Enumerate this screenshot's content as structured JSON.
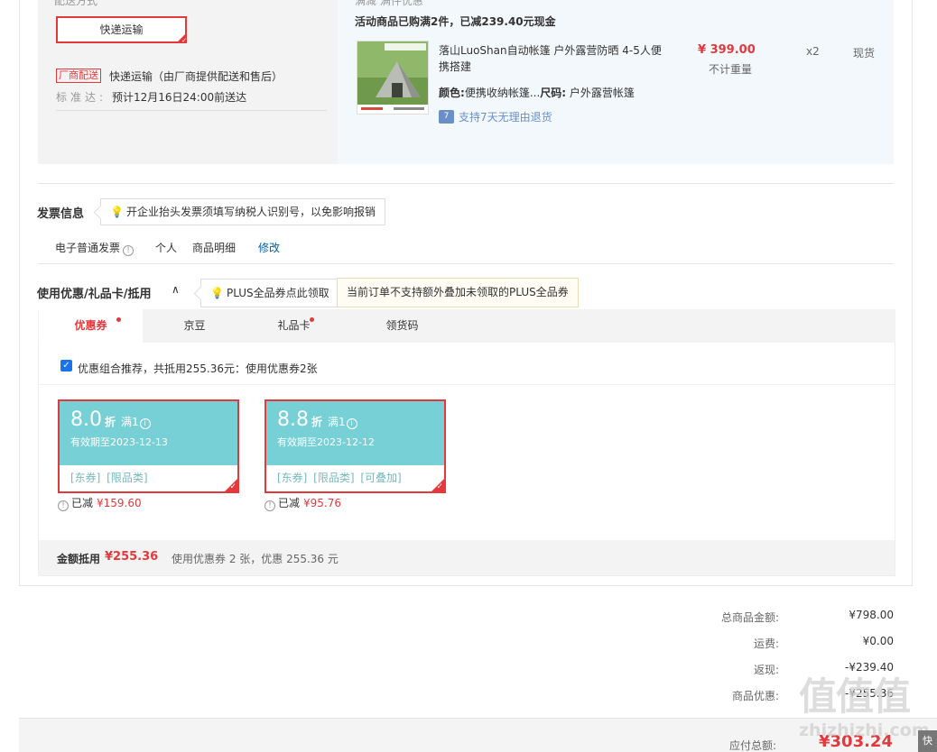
{
  "shipping": {
    "cut_text_left": "配送方式",
    "cut_text_right": "满减 满件优惠",
    "express_button": "快递运输",
    "factory_badge": "厂商配送",
    "factory_text": "快递运输（由厂商提供配送和售后）",
    "standard_label": "标准达:",
    "standard_text": "预计12月16日24:00前送达"
  },
  "product": {
    "promo_title": "活动商品已购满2件，已减239.40元现金",
    "name": "落山LuoShan自动帐篷 户外露营防晒 4-5人便携搭建",
    "price": "¥ 399.00",
    "weight": "不计重量",
    "qty": "x2",
    "stock": "现货",
    "color_label": "颜色:",
    "color_value": "便携收纳帐篷...",
    "size_label": "尺码:",
    "size_value": "户外露营帐篷",
    "return_icon": "7",
    "return_text": "支持7天无理由退货"
  },
  "invoice": {
    "title": "发票信息",
    "tip": "开企业抬头发票须填写纳税人识别号，以免影响报销",
    "type": "电子普通发票",
    "person": "个人",
    "detail": "商品明细",
    "edit": "修改"
  },
  "coupons": {
    "title": "使用优惠/礼品卡/抵用",
    "chevron": "∧",
    "plus_tip": "PLUS全品券点此领取",
    "plus_warn": "当前订单不支持额外叠加未领取的PLUS全品券",
    "tabs": [
      {
        "label": "优惠券",
        "dot": true
      },
      {
        "label": "京豆",
        "dot": false
      },
      {
        "label": "礼品卡",
        "dot": true
      },
      {
        "label": "领货码",
        "dot": false
      }
    ],
    "combo_text": "优惠组合推荐，共抵用255.36元：使用优惠券2张",
    "cards": [
      {
        "discount": "8.0",
        "unit": "折",
        "cond": "满1",
        "valid": "有效期至2023-12-13",
        "tags": "[东券] [限品类]",
        "saved_label": "已减",
        "saved_amount": "¥159.60"
      },
      {
        "discount": "8.8",
        "unit": "折",
        "cond": "满1",
        "valid": "有效期至2023-12-12",
        "tags": "[东券] [限品类] [可叠加]",
        "saved_label": "已减",
        "saved_amount": "¥95.76"
      }
    ],
    "summary_label": "金额抵用",
    "summary_amount": "¥255.36",
    "summary_text": "使用优惠券 2 张，优惠 255.36 元"
  },
  "totals": {
    "rows": [
      {
        "label": "总商品金额:",
        "value": "¥798.00"
      },
      {
        "label": "运费:",
        "value": "¥0.00"
      },
      {
        "label": "返现:",
        "value": "-¥239.40"
      },
      {
        "label": "商品优惠:",
        "value": "-¥255.36"
      }
    ],
    "pay_label": "应付总额:",
    "pay_value": "¥303.24"
  },
  "watermark": {
    "big": "值值值",
    "small": "zhizhizhi.com"
  },
  "side_button": "快速",
  "colors": {
    "accent": "#e4393c",
    "coupon": "#76d0d5",
    "link": "#005ea7"
  }
}
